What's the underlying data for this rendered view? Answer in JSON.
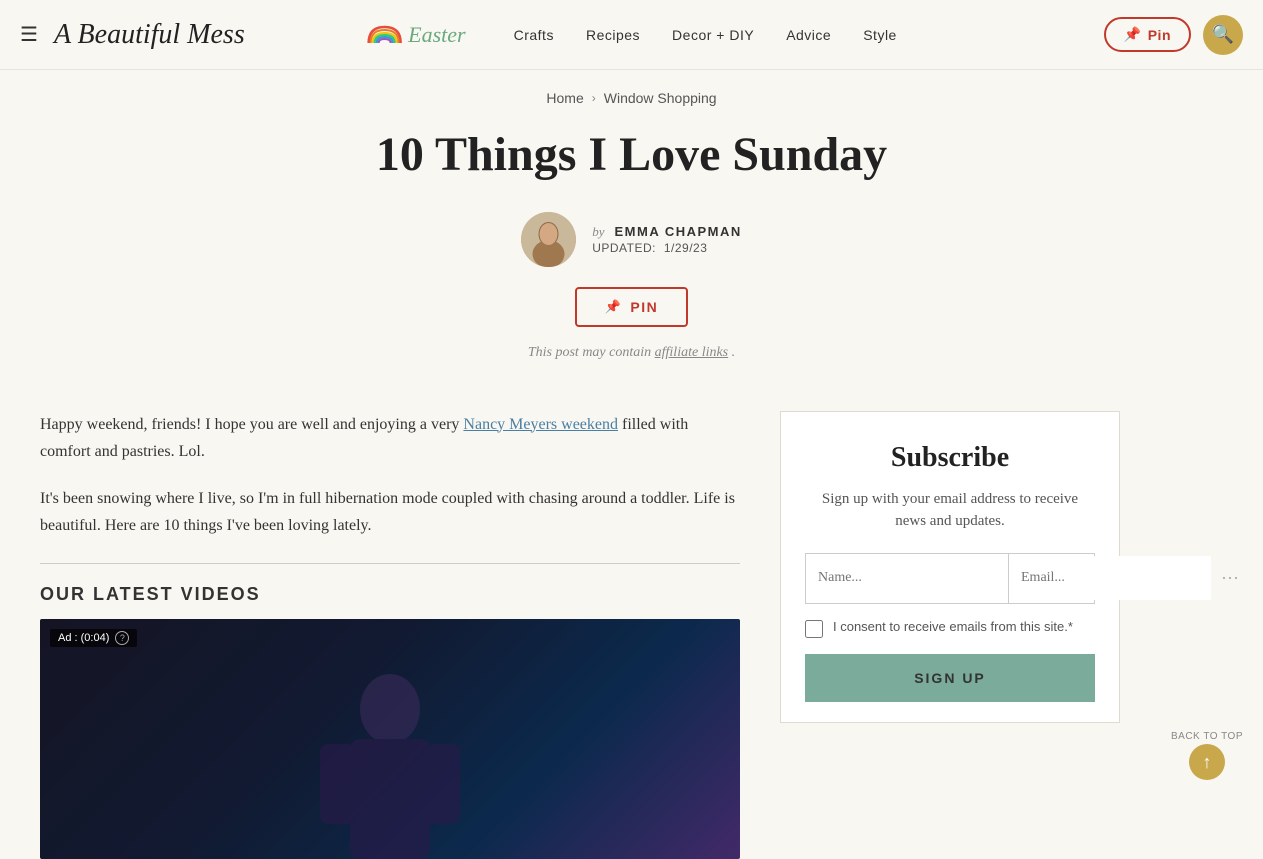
{
  "header": {
    "menu_icon": "☰",
    "logo": "A Beautiful Mess",
    "easter_label": "Easter",
    "nav_items": [
      {
        "label": "Crafts",
        "id": "crafts"
      },
      {
        "label": "Recipes",
        "id": "recipes"
      },
      {
        "label": "Decor + DIY",
        "id": "decor-diy"
      },
      {
        "label": "Advice",
        "id": "advice"
      },
      {
        "label": "Style",
        "id": "style"
      }
    ],
    "pin_label": "Pin",
    "search_icon": "🔍"
  },
  "breadcrumb": {
    "home": "Home",
    "separator": "›",
    "current": "Window Shopping"
  },
  "article": {
    "title": "10 Things I Love Sunday",
    "author_by": "by",
    "author_name": "EMMA CHAPMAN",
    "updated_label": "UPDATED:",
    "updated_date": "1/29/23",
    "pin_button_label": "PIN",
    "affiliate_note": "This post may contain",
    "affiliate_link_text": "affiliate links",
    "affiliate_end": "."
  },
  "body": {
    "intro_part1": "Happy weekend, friends! I hope you are well and enjoying a very ",
    "intro_link": "Nancy Meyers weekend",
    "intro_part2": " filled with comfort and pastries. Lol.",
    "second_para": "It's been snowing where I live, so I'm in full hibernation mode coupled with chasing around a toddler. Life is beautiful. Here are 10 things I've been loving lately.",
    "videos_label": "OUR LATEST VIDEOS",
    "video_ad_text": "Ad : (0:04)",
    "video_info_icon": "?"
  },
  "sidebar": {
    "subscribe_title": "Subscribe",
    "subscribe_desc": "Sign up with your email address to receive news and updates.",
    "name_placeholder": "Name...",
    "email_placeholder": "Email...",
    "consent_text": "I consent to receive emails from this site.*",
    "sign_up_label": "SIGN UP"
  },
  "back_to_top": {
    "label": "BACK TO TOP",
    "arrow": "↑"
  },
  "colors": {
    "accent_red": "#c0392b",
    "accent_gold": "#c8a84b",
    "accent_teal": "#7aab9b",
    "link_blue": "#4a7fa3"
  }
}
